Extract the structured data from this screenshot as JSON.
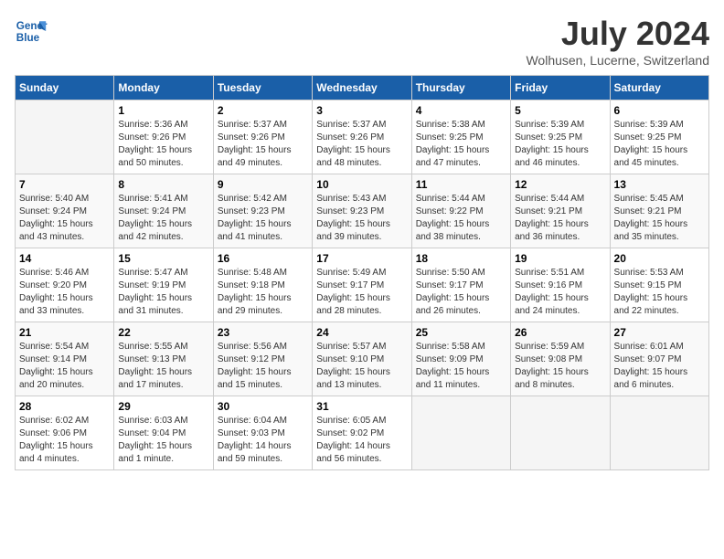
{
  "header": {
    "logo_line1": "General",
    "logo_line2": "Blue",
    "month": "July 2024",
    "location": "Wolhusen, Lucerne, Switzerland"
  },
  "days_of_week": [
    "Sunday",
    "Monday",
    "Tuesday",
    "Wednesday",
    "Thursday",
    "Friday",
    "Saturday"
  ],
  "weeks": [
    [
      {
        "day": null,
        "text": ""
      },
      {
        "day": "1",
        "text": "Sunrise: 5:36 AM\nSunset: 9:26 PM\nDaylight: 15 hours\nand 50 minutes."
      },
      {
        "day": "2",
        "text": "Sunrise: 5:37 AM\nSunset: 9:26 PM\nDaylight: 15 hours\nand 49 minutes."
      },
      {
        "day": "3",
        "text": "Sunrise: 5:37 AM\nSunset: 9:26 PM\nDaylight: 15 hours\nand 48 minutes."
      },
      {
        "day": "4",
        "text": "Sunrise: 5:38 AM\nSunset: 9:25 PM\nDaylight: 15 hours\nand 47 minutes."
      },
      {
        "day": "5",
        "text": "Sunrise: 5:39 AM\nSunset: 9:25 PM\nDaylight: 15 hours\nand 46 minutes."
      },
      {
        "day": "6",
        "text": "Sunrise: 5:39 AM\nSunset: 9:25 PM\nDaylight: 15 hours\nand 45 minutes."
      }
    ],
    [
      {
        "day": "7",
        "text": "Sunrise: 5:40 AM\nSunset: 9:24 PM\nDaylight: 15 hours\nand 43 minutes."
      },
      {
        "day": "8",
        "text": "Sunrise: 5:41 AM\nSunset: 9:24 PM\nDaylight: 15 hours\nand 42 minutes."
      },
      {
        "day": "9",
        "text": "Sunrise: 5:42 AM\nSunset: 9:23 PM\nDaylight: 15 hours\nand 41 minutes."
      },
      {
        "day": "10",
        "text": "Sunrise: 5:43 AM\nSunset: 9:23 PM\nDaylight: 15 hours\nand 39 minutes."
      },
      {
        "day": "11",
        "text": "Sunrise: 5:44 AM\nSunset: 9:22 PM\nDaylight: 15 hours\nand 38 minutes."
      },
      {
        "day": "12",
        "text": "Sunrise: 5:44 AM\nSunset: 9:21 PM\nDaylight: 15 hours\nand 36 minutes."
      },
      {
        "day": "13",
        "text": "Sunrise: 5:45 AM\nSunset: 9:21 PM\nDaylight: 15 hours\nand 35 minutes."
      }
    ],
    [
      {
        "day": "14",
        "text": "Sunrise: 5:46 AM\nSunset: 9:20 PM\nDaylight: 15 hours\nand 33 minutes."
      },
      {
        "day": "15",
        "text": "Sunrise: 5:47 AM\nSunset: 9:19 PM\nDaylight: 15 hours\nand 31 minutes."
      },
      {
        "day": "16",
        "text": "Sunrise: 5:48 AM\nSunset: 9:18 PM\nDaylight: 15 hours\nand 29 minutes."
      },
      {
        "day": "17",
        "text": "Sunrise: 5:49 AM\nSunset: 9:17 PM\nDaylight: 15 hours\nand 28 minutes."
      },
      {
        "day": "18",
        "text": "Sunrise: 5:50 AM\nSunset: 9:17 PM\nDaylight: 15 hours\nand 26 minutes."
      },
      {
        "day": "19",
        "text": "Sunrise: 5:51 AM\nSunset: 9:16 PM\nDaylight: 15 hours\nand 24 minutes."
      },
      {
        "day": "20",
        "text": "Sunrise: 5:53 AM\nSunset: 9:15 PM\nDaylight: 15 hours\nand 22 minutes."
      }
    ],
    [
      {
        "day": "21",
        "text": "Sunrise: 5:54 AM\nSunset: 9:14 PM\nDaylight: 15 hours\nand 20 minutes."
      },
      {
        "day": "22",
        "text": "Sunrise: 5:55 AM\nSunset: 9:13 PM\nDaylight: 15 hours\nand 17 minutes."
      },
      {
        "day": "23",
        "text": "Sunrise: 5:56 AM\nSunset: 9:12 PM\nDaylight: 15 hours\nand 15 minutes."
      },
      {
        "day": "24",
        "text": "Sunrise: 5:57 AM\nSunset: 9:10 PM\nDaylight: 15 hours\nand 13 minutes."
      },
      {
        "day": "25",
        "text": "Sunrise: 5:58 AM\nSunset: 9:09 PM\nDaylight: 15 hours\nand 11 minutes."
      },
      {
        "day": "26",
        "text": "Sunrise: 5:59 AM\nSunset: 9:08 PM\nDaylight: 15 hours\nand 8 minutes."
      },
      {
        "day": "27",
        "text": "Sunrise: 6:01 AM\nSunset: 9:07 PM\nDaylight: 15 hours\nand 6 minutes."
      }
    ],
    [
      {
        "day": "28",
        "text": "Sunrise: 6:02 AM\nSunset: 9:06 PM\nDaylight: 15 hours\nand 4 minutes."
      },
      {
        "day": "29",
        "text": "Sunrise: 6:03 AM\nSunset: 9:04 PM\nDaylight: 15 hours\nand 1 minute."
      },
      {
        "day": "30",
        "text": "Sunrise: 6:04 AM\nSunset: 9:03 PM\nDaylight: 14 hours\nand 59 minutes."
      },
      {
        "day": "31",
        "text": "Sunrise: 6:05 AM\nSunset: 9:02 PM\nDaylight: 14 hours\nand 56 minutes."
      },
      {
        "day": null,
        "text": ""
      },
      {
        "day": null,
        "text": ""
      },
      {
        "day": null,
        "text": ""
      }
    ]
  ]
}
